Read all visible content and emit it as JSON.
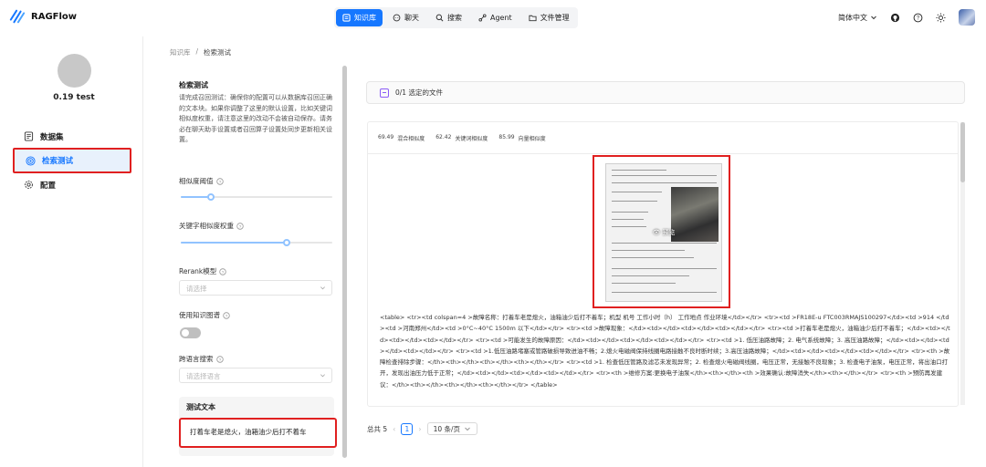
{
  "app": {
    "name": "RAGFlow"
  },
  "nav": {
    "items": [
      {
        "label": "知识库",
        "icon": "database-icon",
        "active": true
      },
      {
        "label": "聊天",
        "icon": "chat-icon",
        "active": false
      },
      {
        "label": "搜索",
        "icon": "search-icon",
        "active": false
      },
      {
        "label": "Agent",
        "icon": "agent-icon",
        "active": false
      },
      {
        "label": "文件管理",
        "icon": "folder-icon",
        "active": false
      }
    ]
  },
  "header": {
    "language": "简体中文",
    "icons": [
      "github-icon",
      "help-icon",
      "theme-icon",
      "avatar"
    ]
  },
  "sidebar": {
    "kb_name": "0.19 test",
    "items": [
      {
        "label": "数据集",
        "icon": "dataset-icon",
        "active": false
      },
      {
        "label": "检索测试",
        "icon": "retrieval-test-icon",
        "active": true
      },
      {
        "label": "配置",
        "icon": "settings-icon",
        "active": false
      }
    ]
  },
  "breadcrumb": {
    "root": "知识库",
    "separator": "/",
    "current": "检索测试"
  },
  "settings": {
    "title": "检索测试",
    "description": "请完成召回测试：确保你的配置可以从数据库召回正确的文本块。如果你调整了这里的默认设置，比如关键词相似度权重，请注意这里的改动不会被自动保存。请务必在聊天助手设置或者召回算子设置处同步更新相关设置。",
    "similarity_threshold_label": "相似度阈值",
    "similarity_threshold_value": 0.2,
    "keyword_weight_label": "关键字相似度权重",
    "keyword_weight_value": 0.7,
    "rerank_label": "Rerank模型",
    "rerank_placeholder": "请选择",
    "knowledge_graph_label": "使用知识图谱",
    "knowledge_graph_enabled": false,
    "cross_language_label": "跨语言搜索",
    "cross_language_placeholder": "请选择语言",
    "test_text_label": "测试文本",
    "test_text_value": "打着车老是熄火，油箱油少后打不着车"
  },
  "results": {
    "selected_files": "0/1 选定的文件",
    "scores": {
      "hybrid_value": "69.49",
      "hybrid_label": "混合相似度",
      "keyword_value": "62.42",
      "keyword_label": "关键词相似度",
      "vector_value": "85.99",
      "vector_label": "向量相似度"
    },
    "preview_label": "预览",
    "chunk_text": "<table> <tr><td colspan=4 >故障名称：打着车老是熄火，油箱油少后打不着车；机型 机号 工作小时（h） 工作地点 作业环境</td></tr> <tr><td >FR18E-u FTC003RMAJS100297</td><td >914 </td><td >河南郑州</td><td >0°C~40°C 1500m 以下</td></tr> <tr><td >故障现象：</td><td></td><td></td><td></td></tr> <tr><td >打着车老是熄火，油箱油少后打不着车；</td><td></td><td></td><td></td></tr> <tr><td >可能发生的故障原因：</td><td></td><td></td><td></td></tr> <tr><td >1. 低压油路故障；2. 电气系统故障；3. 高压油路故障；</td><td></td><td></td><td></td></tr> <tr><td >1.低压油路堵塞或管路破损导致进油不畅；2.熄火电磁阀保持线圈电路接触不良时断时续；3.高压油路故障；</td><td></td><td></td><td></td></tr> <tr><th >故障检查排除步骤：</th><th></th><th></th><th></th></tr> <tr><td >1. 检查低压管路及滤芯未发现异常；2. 检查熄火电磁阀线圈，电压正常，无接触不良现象；3. 检查电子油泵，电压正常，将出油口打开，发现出油压力低于正常；</td><td></td><td></td><td></td></tr> <tr><th >维修方案:更换电子油泵</th><th></th><th >效果确认:故障消失</th><th></th></tr> <tr><th >预防再发建议：</th><th></th><th></th><th></th></tr> </table>"
  },
  "pagination": {
    "total": "总共 5",
    "current_page": "1",
    "page_size": "10 条/页"
  },
  "colors": {
    "accent": "#1677ff",
    "highlight_border": "#e02020",
    "active_bg": "#e8f1fc"
  }
}
